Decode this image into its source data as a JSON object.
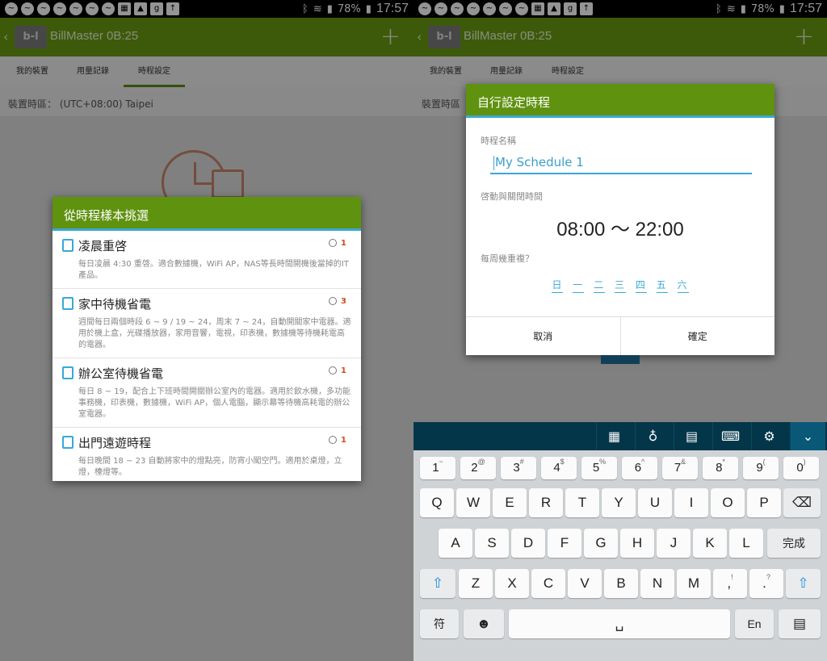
{
  "status_bar": {
    "time": "17:57",
    "battery": "78%"
  },
  "left": {
    "app_title": "BillMaster 0B:25",
    "logo_text": "b-l",
    "tabs": [
      "我的裝置",
      "用量記錄",
      "時程設定"
    ],
    "timezone": "裝置時區：  (UTC+08:00) Taipei",
    "dialog_title": "從時程樣本挑選",
    "templates": [
      {
        "name": "凌晨重啓",
        "count": "1",
        "desc": "每日凌晨 4:30 重啓。適合數據機，WiFi AP，NAS等長時間開機後當掉的IT產品。"
      },
      {
        "name": "家中待機省電",
        "count": "3",
        "desc": "週間每日兩個時段 6 ~ 9 / 19 ~ 24，周末 7 ~ 24，自動開關家中電器。適用於機上盒，光碟播放器，家用音響，電視，印表機，數據機等待機耗電高的電器。"
      },
      {
        "name": "辦公室待機省電",
        "count": "1",
        "desc": "每日 8 ~ 19，配合上下班時間開關辦公室內的電器。適用於飲水機，多功能事務機，印表機，數據機，WiFi AP，個人電腦，顯示幕等待機高耗電的辦公室電器。"
      },
      {
        "name": "出門遠遊時程",
        "count": "1",
        "desc": "每日晚間 18 ~ 23 自動將家中的燈點亮，防宵小闖空門。適用於桌燈，立燈，檯燈等。"
      }
    ]
  },
  "right": {
    "app_title": "BillMaster 0B:25",
    "logo_text": "b-l",
    "tabs": [
      "我的裝置",
      "用量記錄",
      "時程設定"
    ],
    "timezone": "裝置時區",
    "dialog_title": "自行設定時程",
    "name_label": "時程名稱",
    "name_value": "My Schedule 1",
    "time_label": "啓動與關閉時間",
    "time_range": "08:00 ～ 22:00",
    "repeat_label": "每周幾重複？",
    "days": [
      "日",
      "一",
      "二",
      "三",
      "四",
      "五",
      "六"
    ],
    "cancel": "取消",
    "confirm": "確定"
  },
  "keyboard": {
    "number_row": [
      {
        "k": "1",
        "s": "~"
      },
      {
        "k": "2",
        "s": "@"
      },
      {
        "k": "3",
        "s": "#"
      },
      {
        "k": "4",
        "s": "$"
      },
      {
        "k": "5",
        "s": "%"
      },
      {
        "k": "6",
        "s": "^"
      },
      {
        "k": "7",
        "s": "&"
      },
      {
        "k": "8",
        "s": "*"
      },
      {
        "k": "9",
        "s": "("
      },
      {
        "k": "0",
        "s": ")"
      }
    ],
    "row1": [
      "Q",
      "W",
      "E",
      "R",
      "T",
      "Y",
      "U",
      "I",
      "O",
      "P"
    ],
    "row2": [
      "A",
      "S",
      "D",
      "F",
      "G",
      "H",
      "J",
      "K",
      "L"
    ],
    "row3": [
      "Z",
      "X",
      "C",
      "V",
      "B",
      "N",
      "M"
    ],
    "punct1": ",",
    "punct1_sup": "!",
    "punct2": ".",
    "punct2_sup": "?",
    "done": "完成",
    "symbol": "符",
    "lang": "En"
  }
}
